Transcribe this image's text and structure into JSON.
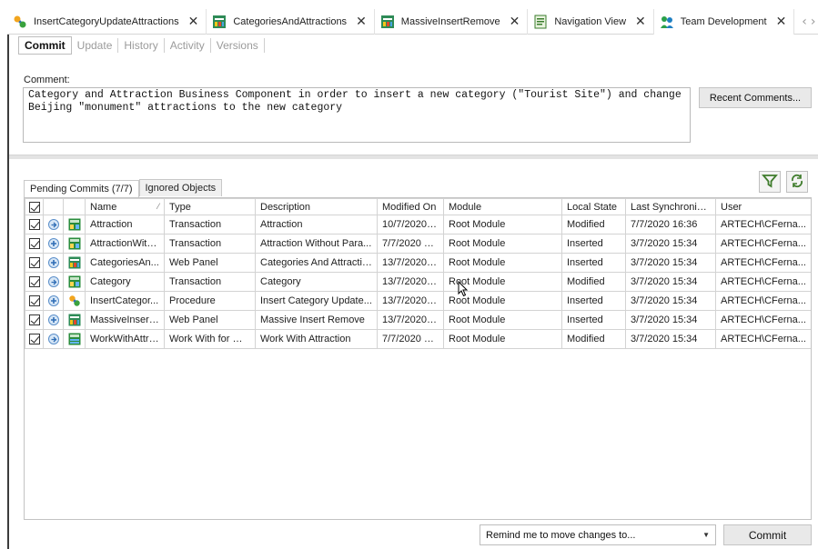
{
  "doc_tabs": [
    {
      "label": "InsertCategoryUpdateAttractions",
      "icon": "procedure-icon",
      "active": false
    },
    {
      "label": "CategoriesAndAttractions",
      "icon": "web-panel-icon",
      "active": false
    },
    {
      "label": "MassiveInsertRemove",
      "icon": "web-panel-icon",
      "active": false
    },
    {
      "label": "Navigation View",
      "icon": "navigation-view-icon",
      "active": false
    },
    {
      "label": "Team Development",
      "icon": "team-development-icon",
      "active": true
    }
  ],
  "inner_tabs": [
    "Commit",
    "Update",
    "History",
    "Activity",
    "Versions"
  ],
  "comment": {
    "label": "Comment:",
    "text": "Category and Attraction Business Component in order to insert a new category (\"Tourist Site\") and change\nBeijing \"monument\" attractions to the new category",
    "recent_button": "Recent Comments..."
  },
  "pending": {
    "tabs": [
      "Pending Commits (7/7)",
      "Ignored Objects"
    ],
    "columns": [
      "Name",
      "Type",
      "Description",
      "Modified On",
      "Module",
      "Local State",
      "Last Synchronized",
      "User"
    ],
    "rows": [
      {
        "name": "Attraction",
        "type": "Transaction",
        "description": "Attraction",
        "modified_on": "10/7/2020 1...",
        "module": "Root Module",
        "local_state": "Modified",
        "last_sync": "7/7/2020 16:36",
        "user": "ARTECH\\CFerna...",
        "action": "modified",
        "icon": "transaction-icon"
      },
      {
        "name": "AttractionWith...",
        "type": "Transaction",
        "description": "Attraction Without Para...",
        "modified_on": "7/7/2020 17...",
        "module": "Root Module",
        "local_state": "Inserted",
        "last_sync": "3/7/2020 15:34",
        "user": "ARTECH\\CFerna...",
        "action": "inserted",
        "icon": "transaction-icon"
      },
      {
        "name": "CategoriesAn...",
        "type": "Web Panel",
        "description": "Categories And Attractio...",
        "modified_on": "13/7/2020 1...",
        "module": "Root Module",
        "local_state": "Inserted",
        "last_sync": "3/7/2020 15:34",
        "user": "ARTECH\\CFerna...",
        "action": "inserted",
        "icon": "web-panel-icon"
      },
      {
        "name": "Category",
        "type": "Transaction",
        "description": "Category",
        "modified_on": "13/7/2020 1...",
        "module": "Root Module",
        "local_state": "Modified",
        "last_sync": "3/7/2020 15:34",
        "user": "ARTECH\\CFerna...",
        "action": "modified",
        "icon": "transaction-icon"
      },
      {
        "name": "InsertCategor...",
        "type": "Procedure",
        "description": "Insert Category Update...",
        "modified_on": "13/7/2020 1...",
        "module": "Root Module",
        "local_state": "Inserted",
        "last_sync": "3/7/2020 15:34",
        "user": "ARTECH\\CFerna...",
        "action": "inserted",
        "icon": "procedure-icon"
      },
      {
        "name": "MassiveInsert...",
        "type": "Web Panel",
        "description": "Massive Insert Remove",
        "modified_on": "13/7/2020 1...",
        "module": "Root Module",
        "local_state": "Inserted",
        "last_sync": "3/7/2020 15:34",
        "user": "ARTECH\\CFerna...",
        "action": "inserted",
        "icon": "web-panel-icon"
      },
      {
        "name": "WorkWithAttra...",
        "type": "Work With for Web",
        "description": "Work With Attraction",
        "modified_on": "7/7/2020 16...",
        "module": "Root Module",
        "local_state": "Modified",
        "last_sync": "3/7/2020 15:34",
        "user": "ARTECH\\CFerna...",
        "action": "modified",
        "icon": "work-with-icon"
      }
    ]
  },
  "footer": {
    "remind_select": "Remind me to move changes to...",
    "commit_button": "Commit"
  }
}
